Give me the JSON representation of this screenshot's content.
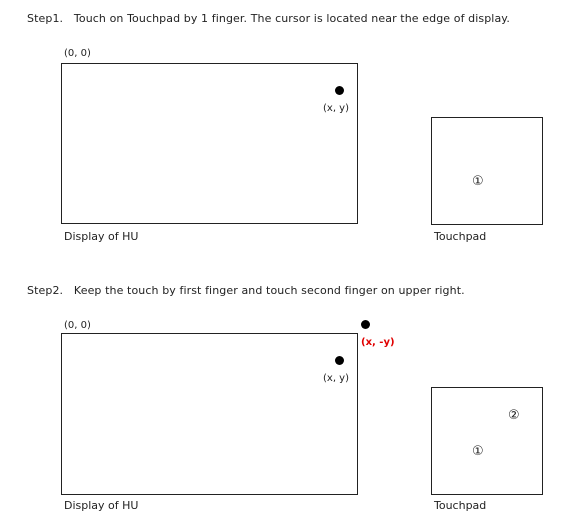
{
  "step1": {
    "instruction": "Step1.   Touch on Touchpad by 1 finger. The cursor is located near the edge of display.",
    "origin_label": "(0, 0)",
    "cursor_label": "(x, y)",
    "display_label": "Display of HU",
    "touchpad_label": "Touchpad",
    "finger1": "①"
  },
  "step2": {
    "instruction": "Step2.   Keep the touch by first finger and touch second finger on upper right.",
    "origin_label": "(0, 0)",
    "cursor_label": "(x, y)",
    "mirrored_label": "(x, -y)",
    "mirrored_color": "#e00000",
    "display_label": "Display of HU",
    "touchpad_label": "Touchpad",
    "finger1": "①",
    "finger2": "②"
  }
}
